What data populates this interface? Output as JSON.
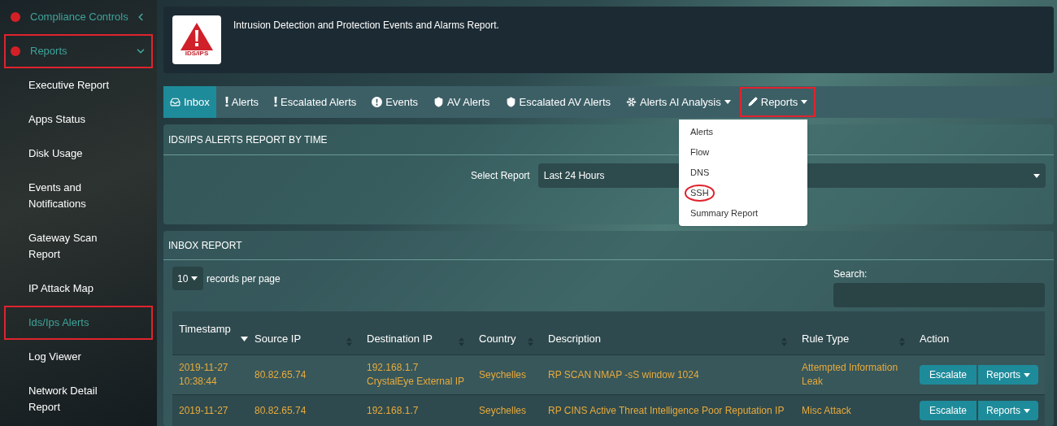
{
  "sidebar": {
    "items": [
      {
        "label": "Compliance Controls",
        "kind": "section",
        "expanded": false,
        "highlighted": false
      },
      {
        "label": "Reports",
        "kind": "section",
        "expanded": true,
        "highlighted": true
      },
      {
        "label": "Executive Report",
        "kind": "link",
        "highlighted": false,
        "selected": false
      },
      {
        "label": "Apps Status",
        "kind": "link",
        "highlighted": false,
        "selected": false
      },
      {
        "label": "Disk Usage",
        "kind": "link",
        "highlighted": false,
        "selected": false
      },
      {
        "label": "Events and Notifications",
        "kind": "link",
        "highlighted": false,
        "selected": false
      },
      {
        "label": "Gateway Scan Report",
        "kind": "link",
        "highlighted": false,
        "selected": false
      },
      {
        "label": "IP Attack Map",
        "kind": "link",
        "highlighted": false,
        "selected": false
      },
      {
        "label": "Ids/Ips Alerts",
        "kind": "link",
        "highlighted": true,
        "selected": true
      },
      {
        "label": "Log Viewer",
        "kind": "link",
        "highlighted": false,
        "selected": false
      },
      {
        "label": "Network Detail Report",
        "kind": "link",
        "highlighted": false,
        "selected": false
      }
    ]
  },
  "header": {
    "logo_text": "IDS/IPS",
    "description": "Intrusion Detection and Protection Events and Alarms Report."
  },
  "tabs": [
    {
      "label": "Inbox",
      "kind": "inbox",
      "selected": true,
      "dropdown": false,
      "highlighted": false
    },
    {
      "label": "Alerts",
      "kind": "exclamation",
      "selected": false,
      "dropdown": false,
      "highlighted": false
    },
    {
      "label": "Escalated Alerts",
      "kind": "exclamation",
      "selected": false,
      "dropdown": false,
      "highlighted": false
    },
    {
      "label": "Events",
      "kind": "info",
      "selected": false,
      "dropdown": false,
      "highlighted": false
    },
    {
      "label": "AV Alerts",
      "kind": "shield",
      "selected": false,
      "dropdown": false,
      "highlighted": false
    },
    {
      "label": "Escalated AV Alerts",
      "kind": "shield",
      "selected": false,
      "dropdown": false,
      "highlighted": false
    },
    {
      "label": "Alerts AI Analysis",
      "kind": "asterisk",
      "selected": false,
      "dropdown": true,
      "highlighted": false
    },
    {
      "label": "Reports",
      "kind": "pencil",
      "selected": false,
      "dropdown": true,
      "highlighted": true
    }
  ],
  "reports_menu": {
    "items": [
      {
        "label": "Alerts",
        "circled": false
      },
      {
        "label": "Flow",
        "circled": false
      },
      {
        "label": "DNS",
        "circled": false
      },
      {
        "label": "SSH",
        "circled": true
      },
      {
        "label": "Summary Report",
        "circled": false
      }
    ]
  },
  "time_panel": {
    "title": "IDS/IPS ALERTS REPORT BY TIME",
    "select_label": "Select Report",
    "select_value": "Last 24 Hours"
  },
  "inbox_panel": {
    "title": "INBOX REPORT",
    "page_size": "10",
    "page_size_label": "records per page",
    "search_label": "Search:",
    "table": {
      "columns": [
        {
          "label": "Timestamp",
          "sortable": true,
          "sorted": true
        },
        {
          "label": "Source IP",
          "sortable": true,
          "sorted": false
        },
        {
          "label": "Destination IP",
          "sortable": true,
          "sorted": false
        },
        {
          "label": "Country",
          "sortable": true,
          "sorted": false
        },
        {
          "label": "Description",
          "sortable": true,
          "sorted": false
        },
        {
          "label": "Rule Type",
          "sortable": true,
          "sorted": false
        },
        {
          "label": "Action",
          "sortable": false,
          "sorted": false
        }
      ],
      "rows": [
        {
          "timestamp": [
            "2019-11-27",
            "10:38:44"
          ],
          "source_ip": "80.82.65.74",
          "destination_ip": [
            "192.168.1.7",
            "CrystalEye External IP"
          ],
          "country": "Seychelles",
          "description": [
            "RP SCAN NMAP -sS window 1024"
          ],
          "rule_type": [
            "Attempted Information",
            "Leak"
          ],
          "actions": [
            "Escalate",
            "Reports"
          ]
        },
        {
          "timestamp": [
            "2019-11-27"
          ],
          "source_ip": "80.82.65.74",
          "destination_ip": [
            "192.168.1.7"
          ],
          "country": "Seychelles",
          "description": [
            "RP CINS Active Threat Intelligence Poor Reputation IP"
          ],
          "rule_type": [
            "Misc Attack"
          ],
          "actions": [
            "Escalate",
            "Reports"
          ]
        }
      ]
    }
  }
}
